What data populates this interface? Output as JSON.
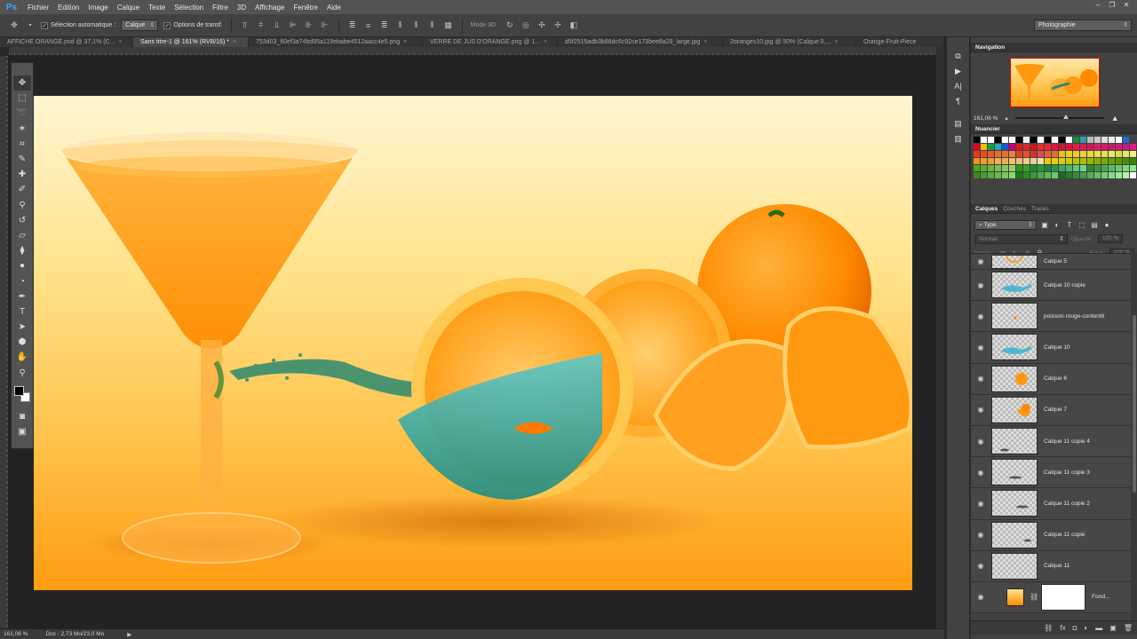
{
  "app": {
    "logo": "Ps"
  },
  "menu": [
    "Fichier",
    "Edition",
    "Image",
    "Calque",
    "Texte",
    "Sélection",
    "Filtre",
    "3D",
    "Affichage",
    "Fenêtre",
    "Aide"
  ],
  "options": {
    "auto_select_label": "Sélection automatique :",
    "auto_select_value": "Calque",
    "transform_label": "Options de transf.",
    "mode3d_label": "Mode 3D :",
    "workspace": "Photographie"
  },
  "tabs": [
    {
      "label": "AFFICHE ORANGE.psd @ 37,1% (C...",
      "active": false
    },
    {
      "label": "Sans titre-1 @ 161% (RVB/16) *",
      "active": true
    },
    {
      "label": "753d03_60ef3a74bd95a119ebabe4512aacc4e5.png",
      "active": false
    },
    {
      "label": "VERRE DE JUS D'ORANGE.png @ 1...",
      "active": false
    },
    {
      "label": "d5f2515adb3b86dc6c92ce173bee8a28_large.jpg",
      "active": false
    },
    {
      "label": "2oranges10.jpg @ 50% (Calque 0,...",
      "active": false
    },
    {
      "label": "Orange-Fruit-Piece",
      "active": false
    }
  ],
  "statusbar": {
    "zoom": "161,06 %",
    "doc": "Doc : 2,73 Mo/23,0 Mo"
  },
  "navigation": {
    "title": "Navigation",
    "zoom": "161,06 %"
  },
  "swatches_panel": {
    "title": "Nuancier",
    "colors": [
      "#000000",
      "#ffffff",
      "#ffffff",
      "#000000",
      "#ffffff",
      "#ffffff",
      "#000000",
      "#eeeeee",
      "#000000",
      "#ffffff",
      "#000000",
      "#ffffff",
      "#000000",
      "#ffffff",
      "#1c8a3a",
      "#2e9ab0",
      "#bbbbbb",
      "#cccccc",
      "#dddddd",
      "#eeeeee",
      "#ffffff",
      "#1a6ad8",
      "#424242",
      "#424242",
      "#424242",
      "#e4002b",
      "#f0c000",
      "#14a03c",
      "#1ab0c0",
      "#1a5ad0",
      "#c8007a",
      "#d81a1a",
      "#d82a2a",
      "#c81a1a",
      "#e03030",
      "#e82a3a",
      "#d81a3a",
      "#c81a3a",
      "#e0103a",
      "#e81a4a",
      "#d81a5a",
      "#c81a5a",
      "#e01a6a",
      "#d81a6a",
      "#c81a6a",
      "#d01a7a",
      "#c81a7a",
      "#e01a8a",
      "#d81a8a",
      "#c01a8a",
      "#e83a1a",
      "#f04a1a",
      "#e85a2a",
      "#f06a2a",
      "#e8702a",
      "#f0803a",
      "#e0402a",
      "#e8502a",
      "#d8302a",
      "#e84a4a",
      "#f05a3a",
      "#e86a3a",
      "#f0c010",
      "#f0d020",
      "#f0c830",
      "#f0d040",
      "#e8d830",
      "#f0e040",
      "#e8e050",
      "#f0e860",
      "#d8e040",
      "#e0e860",
      "#f0f080",
      "#f8f8f8",
      "#ffffff",
      "#f0901a",
      "#f0a02a",
      "#e8a03a",
      "#f0b04a",
      "#e8b05a",
      "#f0c06a",
      "#e8c07a",
      "#f0d08a",
      "#e8d09a",
      "#f0e0aa",
      "#f0c800",
      "#e8d000",
      "#d8d000",
      "#c8d000",
      "#b8c800",
      "#a8c000",
      "#98b800",
      "#88b000",
      "#78a800",
      "#68a000",
      "#589800",
      "#489000",
      "#388800",
      "#288000",
      "#187800",
      "#48a81a",
      "#58b02a",
      "#68b83a",
      "#78c04a",
      "#88c85a",
      "#98d06a",
      "#28981a",
      "#38a02a",
      "#18902a",
      "#28983a",
      "#1a8a3a",
      "#2a9a4a",
      "#3aa85a",
      "#4ab86a",
      "#5ac87a",
      "#6ad88a",
      "#2a8a2a",
      "#3a9a3a",
      "#4aaa4a",
      "#5aba5a",
      "#6aca6a",
      "#7ada7a",
      "#8aea8a",
      "#9afa9a",
      "#aaffaa",
      "#3a8a1a",
      "#4a9a2a",
      "#5aaa3a",
      "#6aba4a",
      "#7aca5a",
      "#8ada6a",
      "#1a7a1a",
      "#2a8a2a",
      "#3a9a3a",
      "#4aaa4a",
      "#5aba5a",
      "#6aca6a",
      "#1a6a1a",
      "#2a7a2a",
      "#3a8a3a",
      "#4a9a4a",
      "#5aaa5a",
      "#6aba6a",
      "#7aca7a",
      "#8ada8a",
      "#9aea9a",
      "#aafaaa",
      "#ffffff",
      "#ffffff",
      "#ffffff"
    ]
  },
  "layers_panel": {
    "tabs": [
      "Calques",
      "Couches",
      "Tracés"
    ],
    "filter": "Type",
    "blend": "Normal",
    "opacity_label": "Opacité :",
    "opacity": "100 %",
    "lock_label": "Verrou :",
    "fill_label": "Fond :",
    "fill": "100 %",
    "layers": [
      {
        "name": "Calque 5",
        "thumb": "ring"
      },
      {
        "name": "Calque 10 copie",
        "thumb": "splash"
      },
      {
        "name": "poisson-rouge-content6",
        "thumb": "fish"
      },
      {
        "name": "Calque 10",
        "thumb": "splash"
      },
      {
        "name": "Calque 6",
        "thumb": "orange"
      },
      {
        "name": "Calque 7",
        "thumb": "slices"
      },
      {
        "name": "Calque 11 copie 4",
        "thumb": "shadow"
      },
      {
        "name": "Calque 11 copie 3",
        "thumb": "shadow"
      },
      {
        "name": "Calque 11 copie 2",
        "thumb": "shadow"
      },
      {
        "name": "Calque 11 copie",
        "thumb": "shadow"
      },
      {
        "name": "Calque 11",
        "thumb": "empty"
      },
      {
        "name": "Fond...",
        "thumb": "fond"
      }
    ]
  }
}
